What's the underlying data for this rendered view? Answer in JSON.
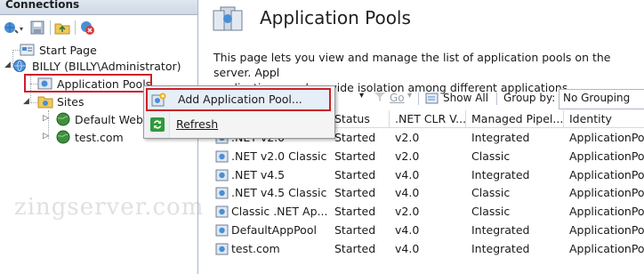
{
  "connections": {
    "header": "Connections",
    "toolbar_icons": [
      "connect-icon",
      "save-icon",
      "folder-up-icon",
      "disconnect-icon"
    ],
    "tree": {
      "start_page": "Start Page",
      "server": "BILLY (BILLY\\Administrator)",
      "application_pools": "Application Pools",
      "sites": "Sites",
      "site_items": [
        "Default Web",
        "test.com"
      ]
    }
  },
  "context_menu": {
    "items": [
      {
        "label": "Add Application Pool...",
        "icon": "add-pool-icon"
      },
      {
        "label": "Refresh",
        "icon": "refresh-icon"
      }
    ]
  },
  "main": {
    "title": "Application Pools",
    "description": "This page lets you view and manage the list of application pools on the server. Appl\napplications, and provide isolation among different applications.",
    "filter_bar": {
      "go": "Go",
      "show_all": "Show All",
      "group_by_label": "Group by:",
      "group_by_value": "No Grouping"
    },
    "columns": [
      "Status",
      ".NET CLR V...",
      "Managed Pipel...",
      "Identity"
    ],
    "rows": [
      {
        "name": ".NET v2.0",
        "status": "Started",
        "clr": "v2.0",
        "pipeline": "Integrated",
        "identity": "ApplicationPo"
      },
      {
        "name": ".NET v2.0 Classic",
        "status": "Started",
        "clr": "v2.0",
        "pipeline": "Classic",
        "identity": "ApplicationPo"
      },
      {
        "name": ".NET v4.5",
        "status": "Started",
        "clr": "v4.0",
        "pipeline": "Integrated",
        "identity": "ApplicationPo"
      },
      {
        "name": ".NET v4.5 Classic",
        "status": "Started",
        "clr": "v4.0",
        "pipeline": "Classic",
        "identity": "ApplicationPo"
      },
      {
        "name": "Classic .NET Ap...",
        "status": "Started",
        "clr": "v2.0",
        "pipeline": "Classic",
        "identity": "ApplicationPo"
      },
      {
        "name": "DefaultAppPool",
        "status": "Started",
        "clr": "v4.0",
        "pipeline": "Integrated",
        "identity": "ApplicationPo"
      },
      {
        "name": "test.com",
        "status": "Started",
        "clr": "v4.0",
        "pipeline": "Integrated",
        "identity": "ApplicationPo"
      }
    ]
  },
  "watermark": "zingserver.com",
  "colors": {
    "highlight_border": "#cc1f2a",
    "menu_bg": "#f4f4f4",
    "header_bg": "#dfe6ef"
  }
}
